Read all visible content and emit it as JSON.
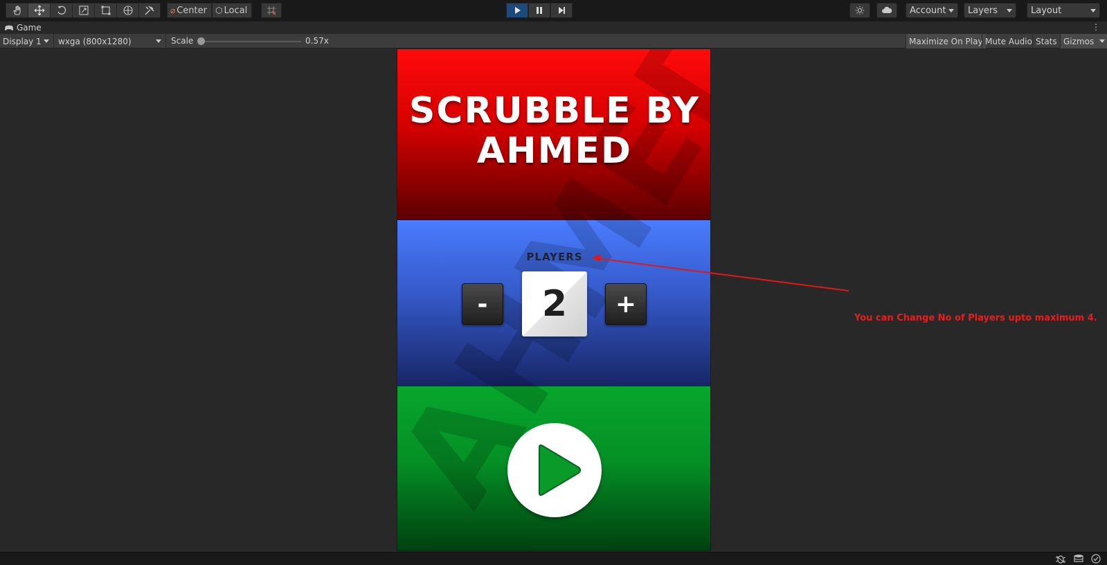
{
  "toolbar": {
    "tools": [
      "hand-tool",
      "move-tool",
      "rotate-tool",
      "scale-tool",
      "rect-tool",
      "transform-tool",
      "custom-tool"
    ],
    "pivot_center": "Center",
    "pivot_local": "Local",
    "account": "Account",
    "layers": "Layers",
    "layout": "Layout"
  },
  "gameview": {
    "tab_label": "Game",
    "display": "Display 1",
    "resolution": "wxga (800x1280)",
    "scale_label": "Scale",
    "scale_value": "0.57x",
    "scale_fraction": 0.02,
    "maximize": "Maximize On Play",
    "mute": "Mute Audio",
    "stats": "Stats",
    "gizmos": "Gizmos"
  },
  "game": {
    "title_line1": "SCRUBBLE BY",
    "title_line2": "AHMED",
    "players_label": "PLAYERS",
    "decrement": "-",
    "increment": "+",
    "player_count": "2",
    "watermark": "AHMED",
    "colors": {
      "red": "#ff0b0b",
      "blue": "#4a7cff",
      "green": "#07a62c"
    }
  },
  "annotation": {
    "text": "You can Change No of Players upto maximum 4.",
    "color": "#e81d1d"
  }
}
